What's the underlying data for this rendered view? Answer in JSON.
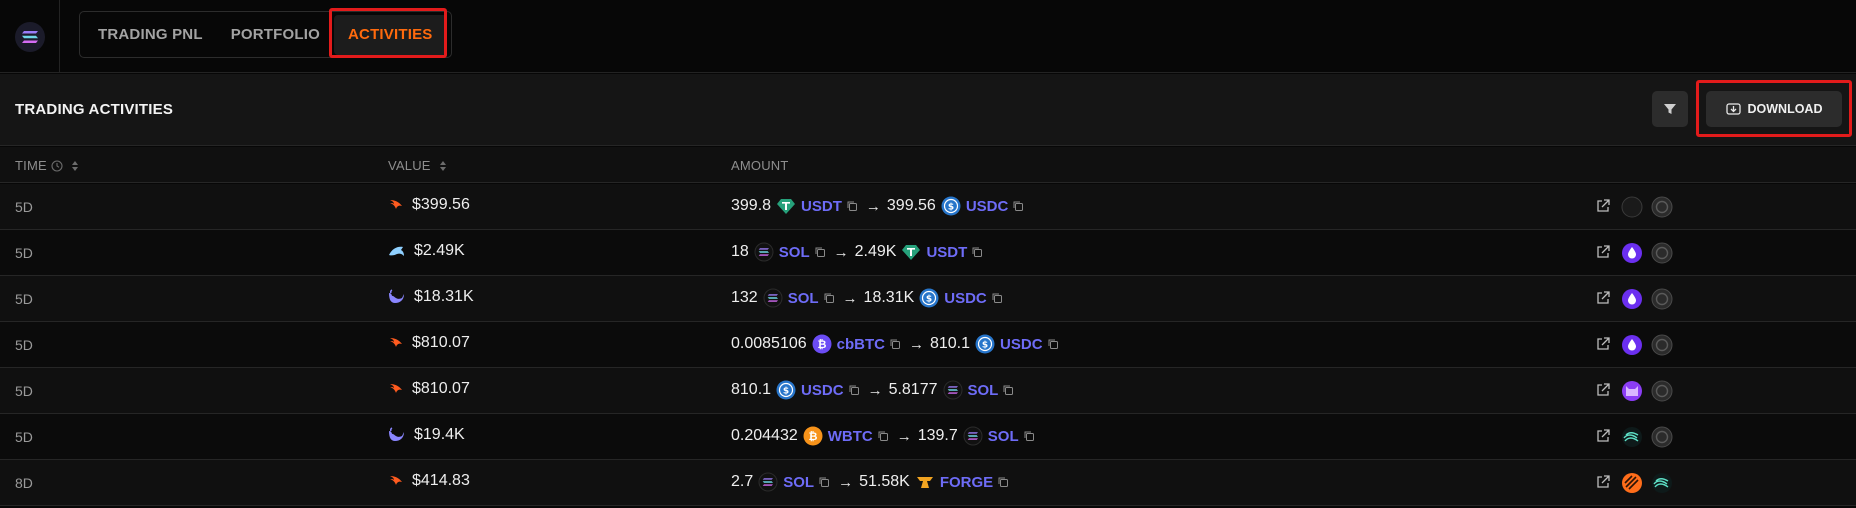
{
  "nav": {
    "tabs": [
      {
        "label": "TRADING PNL"
      },
      {
        "label": "PORTFOLIO"
      },
      {
        "label": "ACTIVITIES"
      }
    ],
    "active_tab": "ACTIVITIES"
  },
  "section": {
    "title": "TRADING ACTIVITIES",
    "download_label": "DOWNLOAD"
  },
  "columns": {
    "time": "TIME",
    "value": "VALUE",
    "amount": "AMOUNT"
  },
  "colors": {
    "accent": "#ff6a0d",
    "token_link": "#6e6cf7",
    "highlight": "#e31b1b"
  },
  "rows": [
    {
      "time": "5D",
      "source_icon": "fire-bird-icon",
      "value": "$399.56",
      "from_amount": "399.8",
      "from_token": "USDT",
      "to_amount": "399.56",
      "to_token": "USDC",
      "badge1": "crescent-icon",
      "badge2": "gray-token-icon"
    },
    {
      "time": "5D",
      "source_icon": "dolphin-icon",
      "value": "$2.49K",
      "from_amount": "18",
      "from_token": "SOL",
      "to_amount": "2.49K",
      "to_token": "USDT",
      "badge1": "drop-icon",
      "badge2": "gray-token-icon"
    },
    {
      "time": "5D",
      "source_icon": "whale-icon",
      "value": "$18.31K",
      "from_amount": "132",
      "from_token": "SOL",
      "to_amount": "18.31K",
      "to_token": "USDC",
      "badge1": "drop-icon",
      "badge2": "gray-token-icon"
    },
    {
      "time": "5D",
      "source_icon": "fire-bird-icon",
      "value": "$810.07",
      "from_amount": "0.0085106",
      "from_token": "cbBTC",
      "to_amount": "810.1",
      "to_token": "USDC",
      "badge1": "drop-icon",
      "badge2": "gray-token-icon"
    },
    {
      "time": "5D",
      "source_icon": "fire-bird-icon",
      "value": "$810.07",
      "from_amount": "810.1",
      "from_token": "USDC",
      "to_amount": "5.8177",
      "to_token": "SOL",
      "badge1": "cat-icon",
      "badge2": "gray-token-icon"
    },
    {
      "time": "5D",
      "source_icon": "whale-icon",
      "value": "$19.4K",
      "from_amount": "0.204432",
      "from_token": "WBTC",
      "to_amount": "139.7",
      "to_token": "SOL",
      "badge1": "wave-icon",
      "badge2": "gray-token-icon"
    },
    {
      "time": "8D",
      "source_icon": "fire-bird-icon",
      "value": "$414.83",
      "from_amount": "2.7",
      "from_token": "SOL",
      "to_amount": "51.58K",
      "to_token": "FORGE",
      "badge1": "stripe-orange-icon",
      "badge2": "wave-icon"
    }
  ]
}
